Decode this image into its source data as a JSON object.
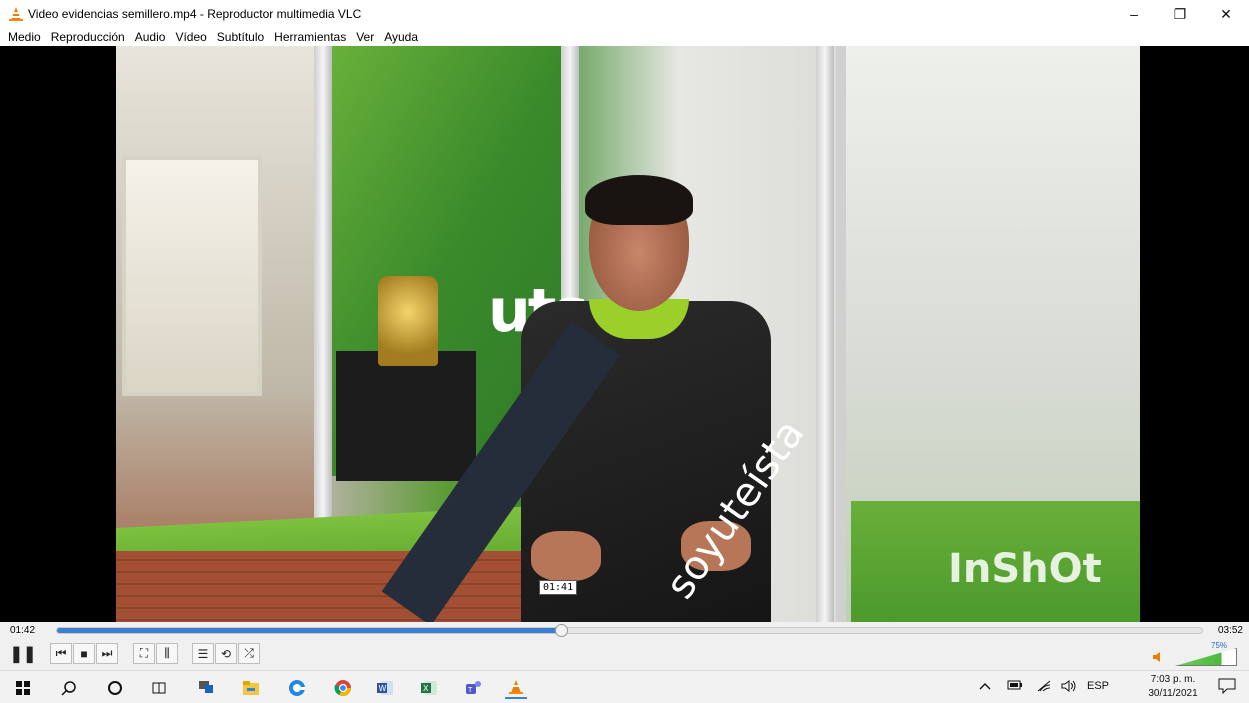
{
  "window": {
    "title": "Video evidencias semillero.mp4 - Reproductor multimedia VLC",
    "minimize_glyph": "–",
    "restore_glyph": "❐",
    "close_glyph": "✕"
  },
  "menu": [
    {
      "label": "Medio"
    },
    {
      "label": "Reproducción"
    },
    {
      "label": "Audio"
    },
    {
      "label": "Vídeo"
    },
    {
      "label": "Subtítulo"
    },
    {
      "label": "Herramientas"
    },
    {
      "label": "Ver"
    },
    {
      "label": "Ayuda"
    }
  ],
  "video": {
    "logo_text": "uts",
    "sash_text": "soyuteísta",
    "watermark": "InShOt",
    "hover_time": "01:41"
  },
  "playback": {
    "elapsed": "01:42",
    "total": "03:52",
    "progress_fraction": 0.44
  },
  "volume": {
    "label": "75%",
    "level_fraction": 0.75
  },
  "controls": {
    "pause_glyph": "❚❚",
    "prev_glyph": "⏮",
    "stop_glyph": "■",
    "next_glyph": "⏭",
    "fullscreen_glyph": "⛶",
    "extended_glyph": "⫼",
    "playlist_glyph": "☰",
    "loop_glyph": "⟲",
    "shuffle_glyph": "⤮"
  },
  "taskbar": {
    "language": "ESP",
    "time": "7:03 p. m.",
    "date": "30/11/2021"
  },
  "colors": {
    "seek_fill": "#3a7fd0",
    "vlc_orange": "#ef7d00",
    "volume_green": "#4cb83f"
  }
}
